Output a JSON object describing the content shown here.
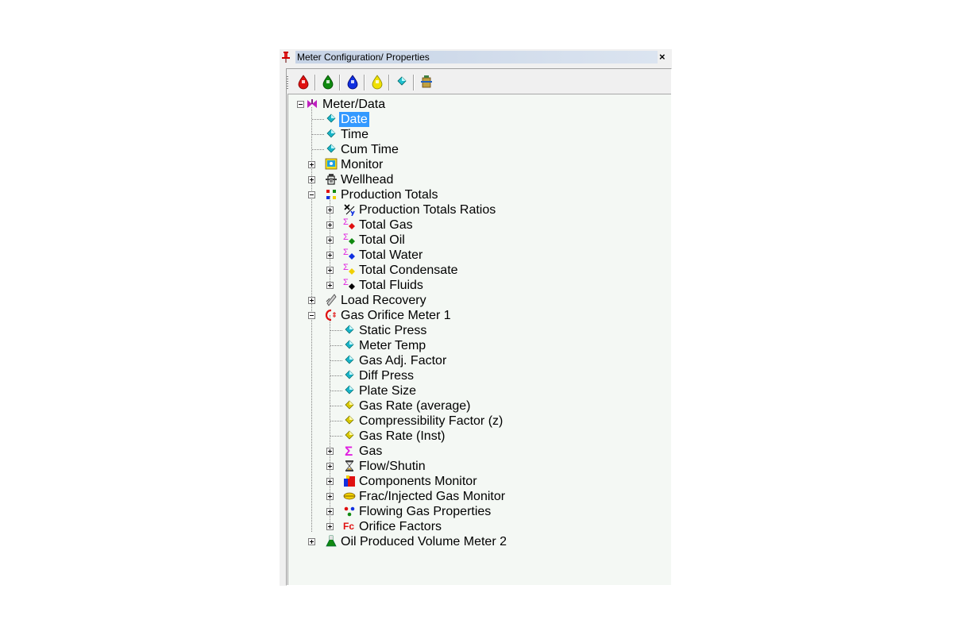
{
  "window": {
    "title": "Meter Configuration/ Properties",
    "close_glyph": "×"
  },
  "toolbar": {
    "buttons": [
      {
        "name": "red-drop-button",
        "color": "#e01010"
      },
      {
        "name": "green-drop-button",
        "color": "#108a10"
      },
      {
        "name": "blue-drop-button",
        "color": "#1030e0"
      },
      {
        "name": "yellow-drop-button",
        "color": "#f0e000"
      },
      {
        "name": "property-button",
        "color": "#20c0c0"
      },
      {
        "name": "meter-button",
        "color": "#a08020"
      }
    ]
  },
  "tree": {
    "root": "Meter/Data",
    "date": "Date",
    "time": "Time",
    "cum_time": "Cum Time",
    "monitor": "Monitor",
    "wellhead": "Wellhead",
    "production_totals": "Production Totals",
    "production_totals_ratios": "Production Totals Ratios",
    "total_gas": "Total Gas",
    "total_oil": "Total Oil",
    "total_water": "Total Water",
    "total_condensate": "Total Condensate",
    "total_fluids": "Total Fluids",
    "load_recovery": "Load Recovery",
    "gas_orifice_meter": "Gas Orifice Meter 1",
    "static_press": "Static Press",
    "meter_temp": "Meter Temp",
    "gas_adj_factor": "Gas Adj. Factor",
    "diff_press": "Diff Press",
    "plate_size": "Plate Size",
    "gas_rate_average": "Gas Rate (average)",
    "compressibility_factor": "Compressibility Factor (z)",
    "gas_rate_inst": "Gas Rate (Inst)",
    "gas": "Gas",
    "flow_shutin": "Flow/Shutin",
    "components_monitor": "Components Monitor",
    "frac_injected_gas_monitor": "Frac/Injected Gas Monitor",
    "flowing_gas_properties": "Flowing Gas Properties",
    "orifice_factors": "Orifice Factors",
    "oil_produced_volume_meter": "Oil Produced Volume Meter 2",
    "fc_icon_text": "Fc",
    "sigma": "Σ"
  },
  "colors": {
    "selection": "#3399ff",
    "cyan_item": "#18b4c8",
    "yellow_item": "#d8c800",
    "sigma": "#e020e0"
  }
}
